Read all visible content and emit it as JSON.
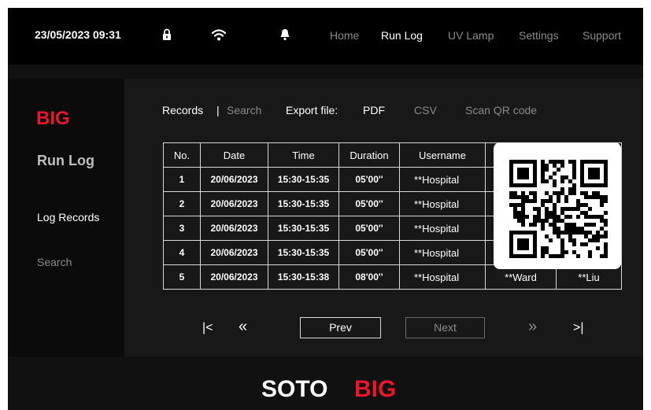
{
  "statusbar": {
    "datetime": "23/05/2023  09:31",
    "icons": [
      "lock-icon",
      "wifi-icon",
      "bell-icon"
    ]
  },
  "nav": {
    "items": [
      {
        "label": "Home",
        "active": false
      },
      {
        "label": "Run Log",
        "active": true
      },
      {
        "label": "UV Lamp",
        "active": false
      },
      {
        "label": "Settings",
        "active": false
      },
      {
        "label": "Support",
        "active": false
      }
    ]
  },
  "sidebar": {
    "logo_text": "BIG",
    "title": "Run Log",
    "items": [
      {
        "label": "Log Records",
        "active": true
      },
      {
        "label": "Search",
        "active": false
      }
    ]
  },
  "toolbar": {
    "records_label": "Records",
    "separator": "|",
    "search_label": "Search",
    "export_label": "Export file:",
    "pdf_label": "PDF",
    "csv_label": "CSV",
    "qr_label": "Scan QR code"
  },
  "table": {
    "headers": [
      "No.",
      "Date",
      "Time",
      "Duration",
      "Username",
      "",
      ""
    ],
    "rows": [
      [
        "1",
        "20/06/2023",
        "15:30-15:35",
        "05'00''",
        "**Hospital",
        "",
        ""
      ],
      [
        "2",
        "20/06/2023",
        "15:30-15:35",
        "05'00''",
        "**Hospital",
        "",
        ""
      ],
      [
        "3",
        "20/06/2023",
        "15:30-15:35",
        "05'00''",
        "**Hospital",
        "",
        ""
      ],
      [
        "4",
        "20/06/2023",
        "15:30-15:35",
        "05'00''",
        "**Hospital",
        "",
        ""
      ],
      [
        "5",
        "20/06/2023",
        "15:30-15:38",
        "08'00''",
        "**Hospital",
        "**Ward",
        "**Liu"
      ]
    ]
  },
  "pagination": {
    "first": "|<",
    "rewind": "«",
    "prev": "Prev",
    "next": "Next",
    "forward": "»",
    "last": ">|"
  },
  "footer": {
    "brand_left": "SOTO",
    "brand_right": "BIG"
  },
  "colors": {
    "brand_red": "#e8172c",
    "background": "#0b0b0b",
    "panel": "#181818",
    "text_muted": "#8a8a8a"
  }
}
